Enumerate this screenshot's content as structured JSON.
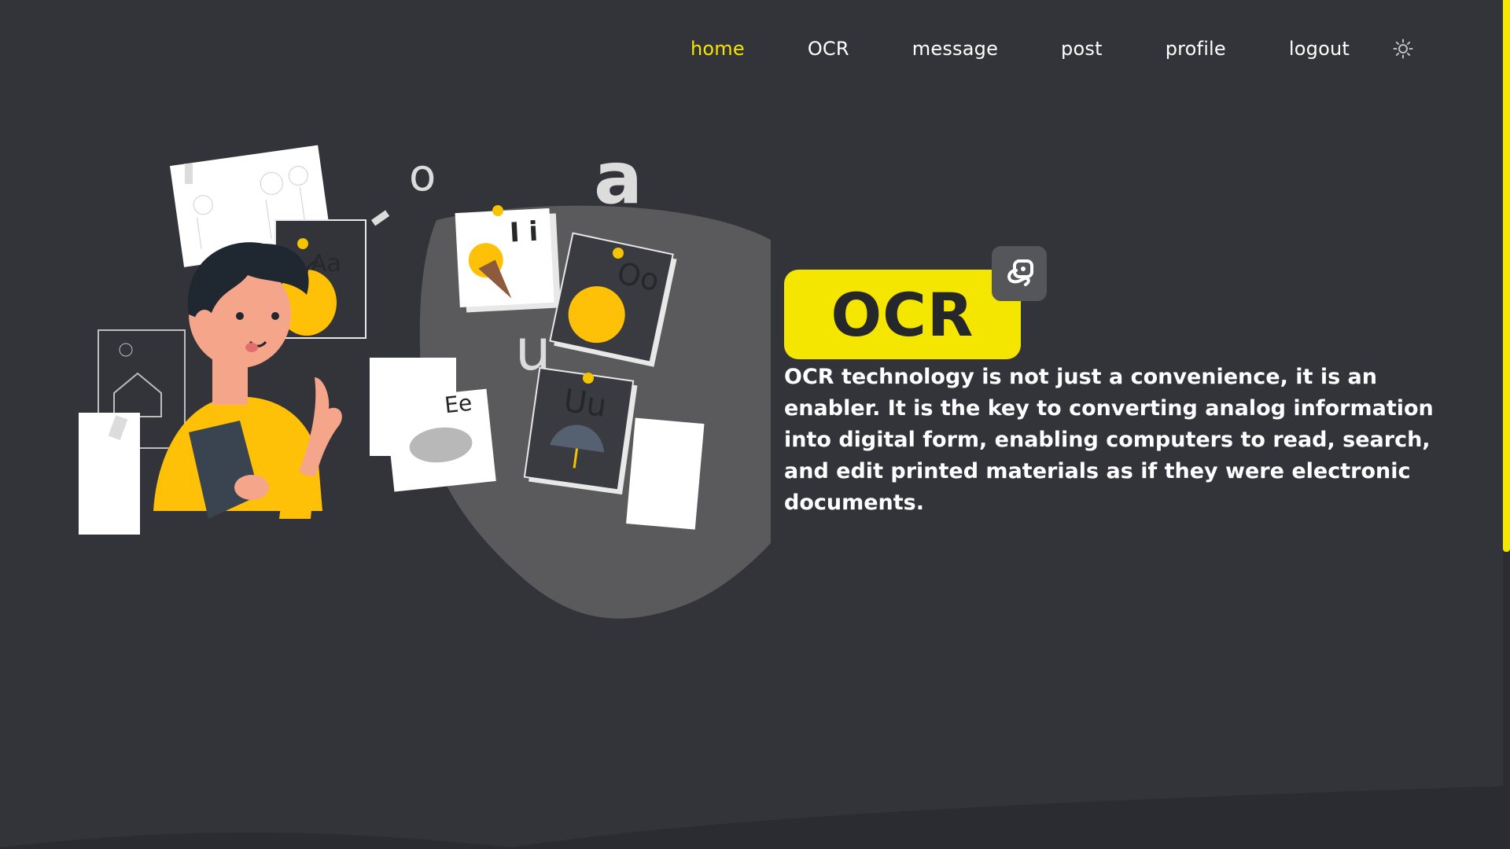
{
  "nav": {
    "items": [
      {
        "label": "home",
        "active": true
      },
      {
        "label": "OCR",
        "active": false
      },
      {
        "label": "message",
        "active": false
      },
      {
        "label": "post",
        "active": false
      },
      {
        "label": "profile",
        "active": false
      },
      {
        "label": "logout",
        "active": false
      }
    ],
    "theme_toggle_icon": "sun-icon"
  },
  "hero": {
    "title": "OCR",
    "badge_icon": "ocr-scan-icon",
    "description": "OCR technology is not just a convenience, it is an enabler. It is the key to converting analog information into digital form, enabling computers to read, search, and edit printed materials as if they were electronic documents.",
    "illustration": {
      "letters": [
        "o",
        "a",
        "u",
        "i"
      ],
      "cards": [
        "Aa",
        "Ii",
        "Oo",
        "Uu",
        "Ee"
      ]
    }
  },
  "colors": {
    "background": "#33343a",
    "accent": "#f5e600",
    "blob": "#5a5a5c",
    "text": "#ffffff",
    "title_text": "#26272b"
  }
}
